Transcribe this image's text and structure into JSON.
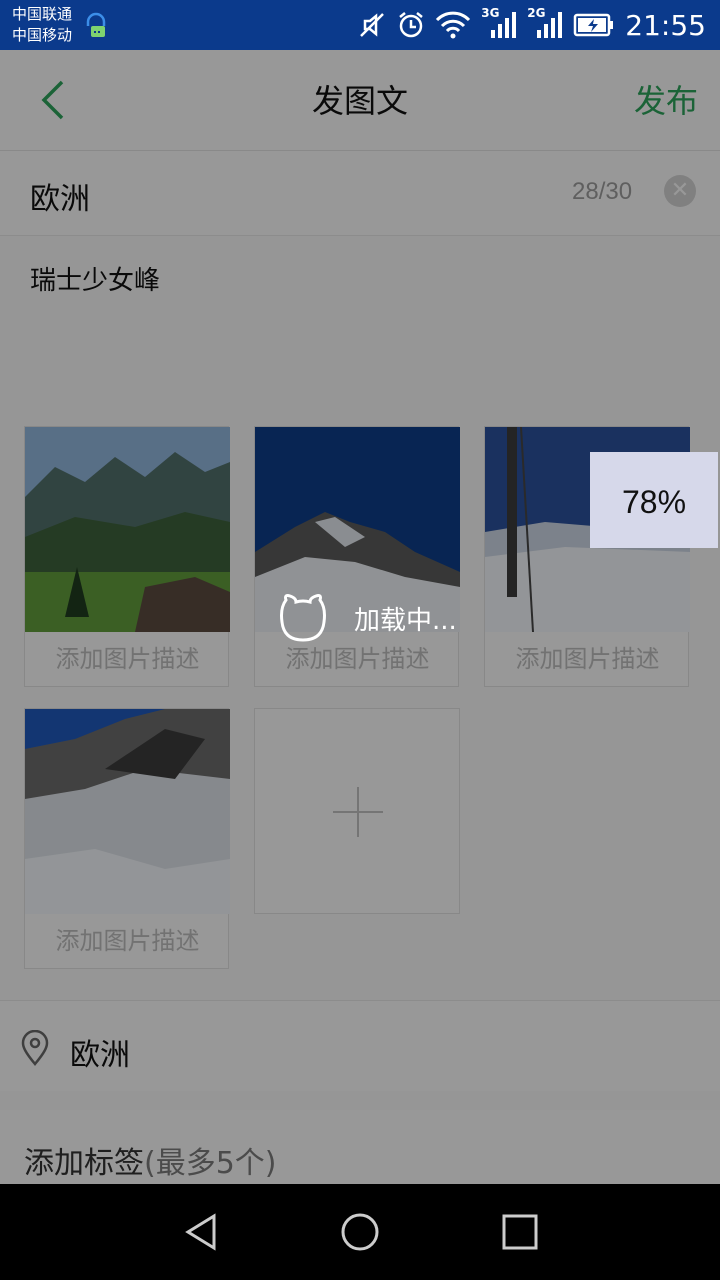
{
  "status_bar": {
    "carrier_1": "中国联通",
    "carrier_2": "中国移动",
    "net_1": "3G",
    "net_2": "2G",
    "time": "21:55"
  },
  "header": {
    "title": "发图文",
    "publish_label": "发布"
  },
  "post": {
    "title_value": "欧洲",
    "char_counter": "28/30",
    "content_value": "瑞士少女峰"
  },
  "photos": {
    "description_placeholder": "添加图片描述",
    "upload_progress": "78%",
    "loading_text": "加载中..."
  },
  "location": {
    "value": "欧洲"
  },
  "tags": {
    "label": "添加标签",
    "limit": "(最多5个)"
  },
  "colors": {
    "accent": "#2ca05a",
    "status_bar": "#0b3a8c"
  }
}
